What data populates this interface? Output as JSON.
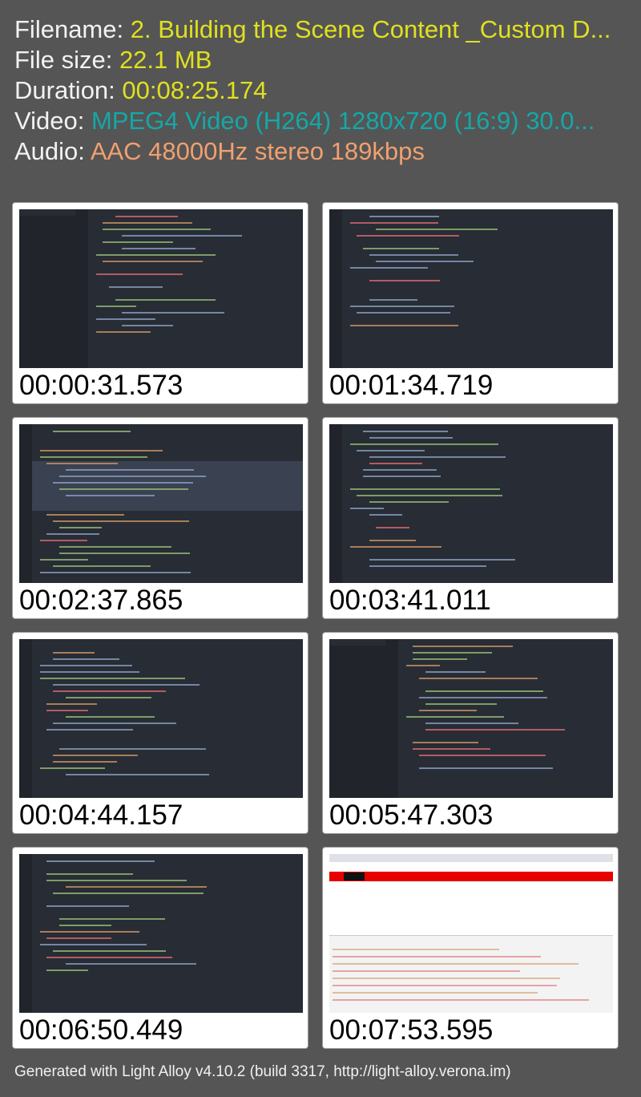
{
  "info": {
    "filename_label": "Filename:",
    "filename_value": "2. Building the Scene Content _Custom D...",
    "filesize_label": "File size:",
    "filesize_value": "22.1 MB",
    "duration_label": "Duration:",
    "duration_value": "00:08:25.174",
    "video_label": "Video:",
    "video_value": "MPEG4 Video (H264) 1280x720 (16:9) 30.0...",
    "audio_label": "Audio:",
    "audio_value": "AAC 48000Hz stereo 189kbps"
  },
  "thumbnails": [
    {
      "timestamp": "00:00:31.573",
      "kind": "editor-with-sidebar"
    },
    {
      "timestamp": "00:01:34.719",
      "kind": "editor"
    },
    {
      "timestamp": "00:02:37.865",
      "kind": "editor-selection"
    },
    {
      "timestamp": "00:03:41.011",
      "kind": "editor"
    },
    {
      "timestamp": "00:04:44.157",
      "kind": "editor"
    },
    {
      "timestamp": "00:05:47.303",
      "kind": "editor-with-sidebar"
    },
    {
      "timestamp": "00:06:50.449",
      "kind": "editor"
    },
    {
      "timestamp": "00:07:53.595",
      "kind": "browser-devtools"
    }
  ],
  "footer": {
    "text": "Generated with Light Alloy v4.10.2 (build 3317, http://light-alloy.verona.im)"
  },
  "colors": {
    "background": "#555555",
    "label": "#f2f2f2",
    "filename_value": "#e0e020",
    "video_value": "#14a8a8",
    "audio_value": "#f0a070"
  }
}
